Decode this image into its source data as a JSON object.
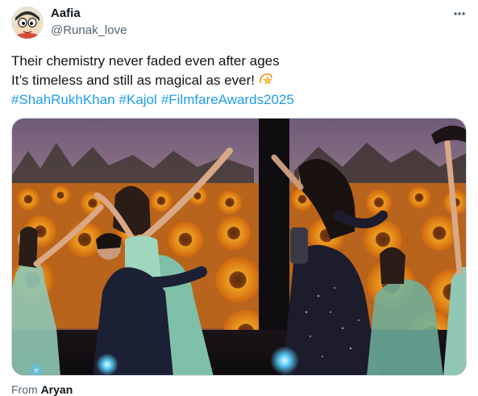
{
  "author": {
    "display_name": "Aafia",
    "handle": "@Runak_love",
    "avatar": "cartoon-face-avatar"
  },
  "more_menu": {
    "icon": "more-horizontal-icon"
  },
  "tweet": {
    "line1": "Their chemistry never faded even after ages",
    "line2": "It’s timeless and still as magical as ever!",
    "emoji": "dizzy-star-emoji",
    "hashtags": [
      "#ShahRukhKhan",
      "#Kajol",
      "#FilmfareAwards2025"
    ]
  },
  "media": {
    "type": "video-still",
    "scene": "stage-performance-sunflower-backdrop"
  },
  "attribution": {
    "prefix": "From",
    "source": "Aryan"
  },
  "colors": {
    "link": "#1d9bf0",
    "text": "#0f1419",
    "secondary": "#536471",
    "border": "#cfd9de"
  }
}
